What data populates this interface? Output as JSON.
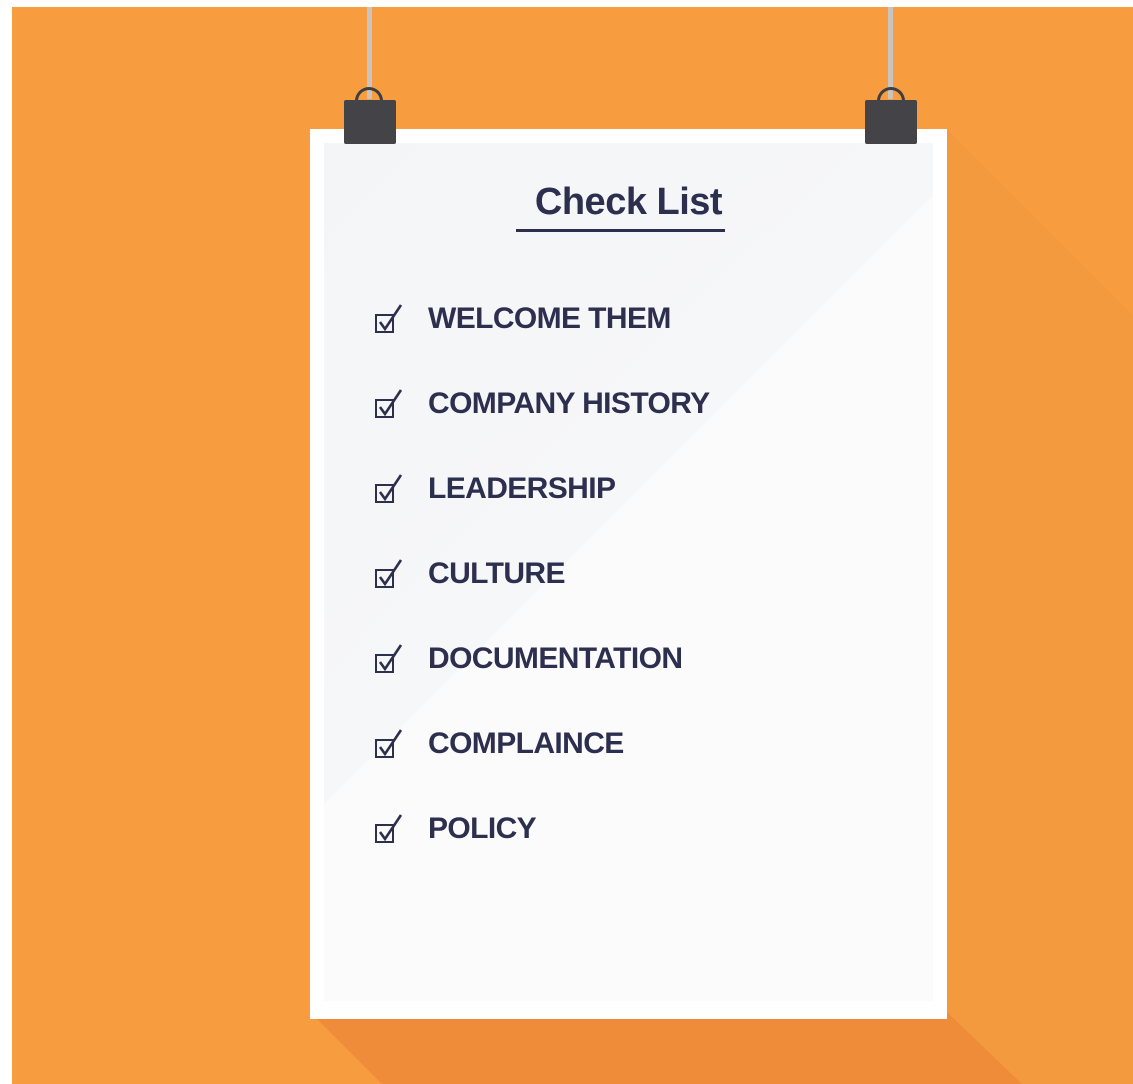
{
  "poster": {
    "title": "Check List",
    "items": [
      {
        "label": "WELCOME THEM",
        "icon": "checked-box-icon"
      },
      {
        "label": "COMPANY HISTORY",
        "icon": "checked-box-icon"
      },
      {
        "label": "LEADERSHIP",
        "icon": "checked-box-icon"
      },
      {
        "label": "CULTURE",
        "icon": "checked-box-icon"
      },
      {
        "label": "DOCUMENTATION",
        "icon": "checked-box-icon"
      },
      {
        "label": "COMPLAINCE",
        "icon": "checked-box-icon"
      },
      {
        "label": "POLICY",
        "icon": "checked-box-icon"
      }
    ]
  },
  "colors": {
    "background": "#f89d3f",
    "shadow": "#ee8c3a",
    "paper": "#ffffff",
    "text": "#2d2f4e",
    "clip": "#444448"
  }
}
